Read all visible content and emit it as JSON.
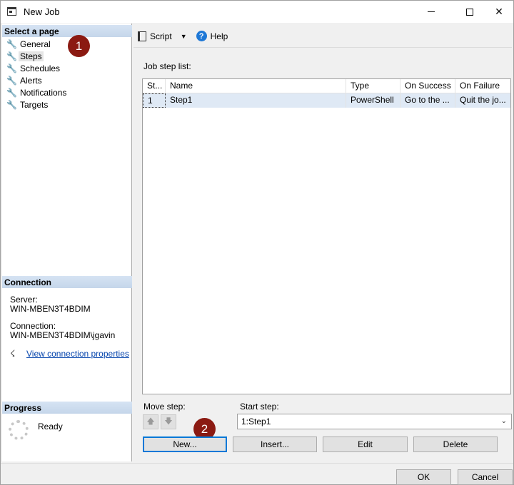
{
  "window": {
    "title": "New Job",
    "minimize_glyph": "",
    "maximize_glyph": "",
    "close_glyph": "✕"
  },
  "left_pane": {
    "select_header": "Select a page",
    "pages": [
      {
        "label": "General",
        "icon": "wrench-icon"
      },
      {
        "label": "Steps",
        "icon": "wrench-icon",
        "selected": true
      },
      {
        "label": "Schedules",
        "icon": "wrench-icon"
      },
      {
        "label": "Alerts",
        "icon": "wrench-icon"
      },
      {
        "label": "Notifications",
        "icon": "wrench-icon"
      },
      {
        "label": "Targets",
        "icon": "wrench-icon"
      }
    ],
    "connection_header": "Connection",
    "server_label": "Server:",
    "server_value": "WIN-MBEN3T4BDIM",
    "connection_label": "Connection:",
    "connection_value": "WIN-MBEN3T4BDIM\\jgavin",
    "view_connection_link": "View connection properties",
    "progress_header": "Progress",
    "progress_status": "Ready"
  },
  "toolbar": {
    "script_label": "Script",
    "help_label": "Help"
  },
  "job_steps": {
    "list_label": "Job step list:",
    "columns": [
      "St...",
      "Name",
      "Type",
      "On Success",
      "On Failure"
    ],
    "rows": [
      [
        "1",
        "Step1",
        "PowerShell",
        "Go to the ...",
        "Quit the jo..."
      ]
    ]
  },
  "move_step": {
    "label": "Move step:"
  },
  "start_step": {
    "label": "Start step:",
    "value": "1:Step1"
  },
  "buttons": {
    "new": "New...",
    "insert": "Insert...",
    "edit": "Edit",
    "delete": "Delete",
    "ok": "OK",
    "cancel": "Cancel"
  },
  "callouts": {
    "one": "1",
    "two": "2",
    "color": "#8b1a12"
  },
  "colors": {
    "section_header": "#c5d6ea",
    "selected_row": "#dfe9f5",
    "link": "#0645ad",
    "help_icon": "#1e78d6"
  }
}
